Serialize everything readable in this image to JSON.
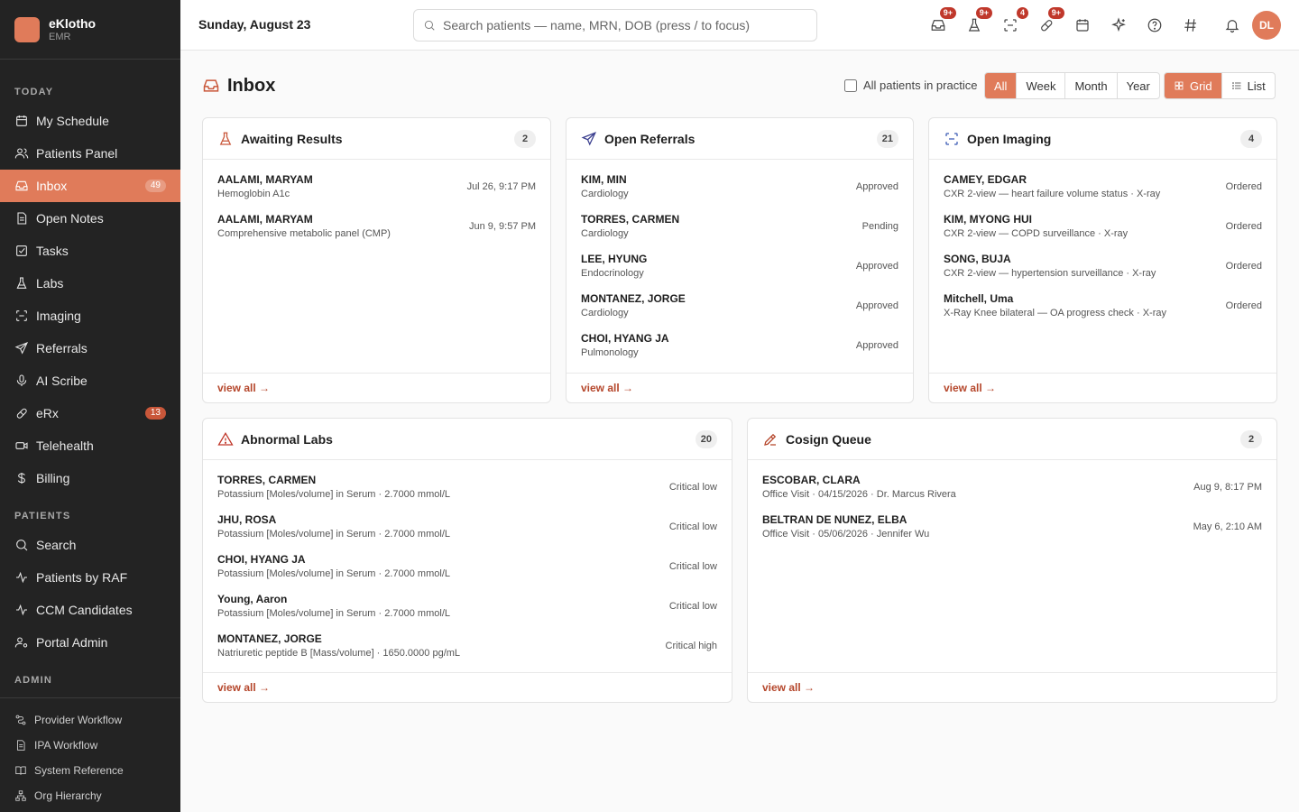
{
  "brand": {
    "name": "eKlotho",
    "sub": "EMR"
  },
  "sidebar": {
    "today_label": "TODAY",
    "today": [
      {
        "label": "My Schedule",
        "icon": "calendar-icon"
      },
      {
        "label": "Patients Panel",
        "icon": "users-icon"
      },
      {
        "label": "Inbox",
        "icon": "inbox-icon",
        "badge": "49",
        "active": true
      },
      {
        "label": "Open Notes",
        "icon": "note-icon"
      },
      {
        "label": "Tasks",
        "icon": "checkbox-icon"
      },
      {
        "label": "Labs",
        "icon": "flask-icon"
      },
      {
        "label": "Imaging",
        "icon": "scan-icon"
      },
      {
        "label": "Referrals",
        "icon": "send-icon"
      },
      {
        "label": "AI Scribe",
        "icon": "microphone-icon"
      },
      {
        "label": "eRx",
        "icon": "pill-icon",
        "badge": "13"
      },
      {
        "label": "Telehealth",
        "icon": "video-icon"
      },
      {
        "label": "Billing",
        "icon": "dollar-icon"
      }
    ],
    "patients_label": "PATIENTS",
    "patients": [
      {
        "label": "Search",
        "icon": "search-icon"
      },
      {
        "label": "Patients by RAF",
        "icon": "activity-icon"
      },
      {
        "label": "CCM Candidates",
        "icon": "activity-icon"
      },
      {
        "label": "Portal Admin",
        "icon": "user-cog-icon"
      }
    ],
    "admin_label": "ADMIN",
    "admin": [
      {
        "label": "Provider Workflow",
        "icon": "workflow-icon"
      },
      {
        "label": "IPA Workflow",
        "icon": "document-icon"
      },
      {
        "label": "System Reference",
        "icon": "book-icon"
      },
      {
        "label": "Org Hierarchy",
        "icon": "hierarchy-icon"
      }
    ]
  },
  "topbar": {
    "date": "Sunday, August 23",
    "search_placeholder": "Search patients — name, MRN, DOB (press / to focus)",
    "icons": [
      {
        "name": "inbox-icon",
        "badge": "9+"
      },
      {
        "name": "flask-icon",
        "badge": "9+"
      },
      {
        "name": "scan-icon",
        "badge": "4"
      },
      {
        "name": "pill-icon",
        "badge": "9+"
      },
      {
        "name": "calendar-icon",
        "badge": ""
      },
      {
        "name": "sparkle-icon",
        "badge": ""
      },
      {
        "name": "help-icon",
        "badge": ""
      },
      {
        "name": "hash-icon",
        "badge": ""
      },
      {
        "name": "bell-icon",
        "badge": ""
      }
    ],
    "avatar_initials": "DL"
  },
  "main": {
    "title": "Inbox",
    "all_patients_label": "All patients in practice",
    "ranges": [
      "All",
      "Week",
      "Month",
      "Year"
    ],
    "active_range": "All",
    "views": [
      "Grid",
      "List"
    ],
    "active_view": "Grid",
    "view_all_label": "view all →",
    "cards": {
      "awaiting": {
        "title": "Awaiting Results",
        "count": "2",
        "rows": [
          {
            "name": "AALAMI, MARYAM",
            "sub": "Hemoglobin A1c",
            "right": "Jul 26, 9:17 PM"
          },
          {
            "name": "AALAMI, MARYAM",
            "sub": "Comprehensive metabolic panel (CMP)",
            "right": "Jun 9, 9:57 PM"
          }
        ]
      },
      "referrals": {
        "title": "Open Referrals",
        "count": "21",
        "rows": [
          {
            "name": "KIM, MIN",
            "sub": "Cardiology",
            "right": "Approved"
          },
          {
            "name": "TORRES, CARMEN",
            "sub": "Cardiology",
            "right": "Pending"
          },
          {
            "name": "LEE, HYUNG",
            "sub": "Endocrinology",
            "right": "Approved"
          },
          {
            "name": "MONTANEZ, JORGE",
            "sub": "Cardiology",
            "right": "Approved"
          },
          {
            "name": "CHOI, HYANG JA",
            "sub": "Pulmonology",
            "right": "Approved"
          }
        ]
      },
      "imaging": {
        "title": "Open Imaging",
        "count": "4",
        "rows": [
          {
            "name": "CAMEY, EDGAR",
            "sub": "CXR 2-view — heart failure volume status · X-ray",
            "right": "Ordered"
          },
          {
            "name": "KIM, MYONG HUI",
            "sub": "CXR 2-view — COPD surveillance · X-ray",
            "right": "Ordered"
          },
          {
            "name": "SONG, BUJA",
            "sub": "CXR 2-view — hypertension surveillance · X-ray",
            "right": "Ordered"
          },
          {
            "name": "Mitchell, Uma",
            "sub": "X-Ray Knee bilateral — OA progress check · X-ray",
            "right": "Ordered"
          }
        ]
      },
      "abnormal": {
        "title": "Abnormal Labs",
        "count": "20",
        "rows": [
          {
            "name": "TORRES, CARMEN",
            "sub": "Potassium [Moles/volume] in Serum · 2.7000 mmol/L",
            "right": "Critical low"
          },
          {
            "name": "JHU, ROSA",
            "sub": "Potassium [Moles/volume] in Serum · 2.7000 mmol/L",
            "right": "Critical low"
          },
          {
            "name": "CHOI, HYANG JA",
            "sub": "Potassium [Moles/volume] in Serum · 2.7000 mmol/L",
            "right": "Critical low"
          },
          {
            "name": "Young, Aaron",
            "sub": "Potassium [Moles/volume] in Serum · 2.7000 mmol/L",
            "right": "Critical low"
          },
          {
            "name": "MONTANEZ, JORGE",
            "sub": "Natriuretic peptide B [Mass/volume] · 1650.0000 pg/mL",
            "right": "Critical high"
          }
        ]
      },
      "cosign": {
        "title": "Cosign Queue",
        "count": "2",
        "rows": [
          {
            "name": "ESCOBAR, CLARA",
            "sub": "Office Visit · 04/15/2026 · Dr. Marcus Rivera",
            "right": "Aug 9, 8:17 PM"
          },
          {
            "name": "BELTRAN DE NUNEZ, ELBA",
            "sub": "Office Visit · 05/06/2026 · Jennifer Wu",
            "right": "May 6, 2:10 AM"
          }
        ]
      }
    }
  },
  "colors": {
    "accent": "#e07b5a",
    "sidebar_bg": "#232323",
    "badge_red": "#c0382b",
    "link": "#b5472c"
  }
}
